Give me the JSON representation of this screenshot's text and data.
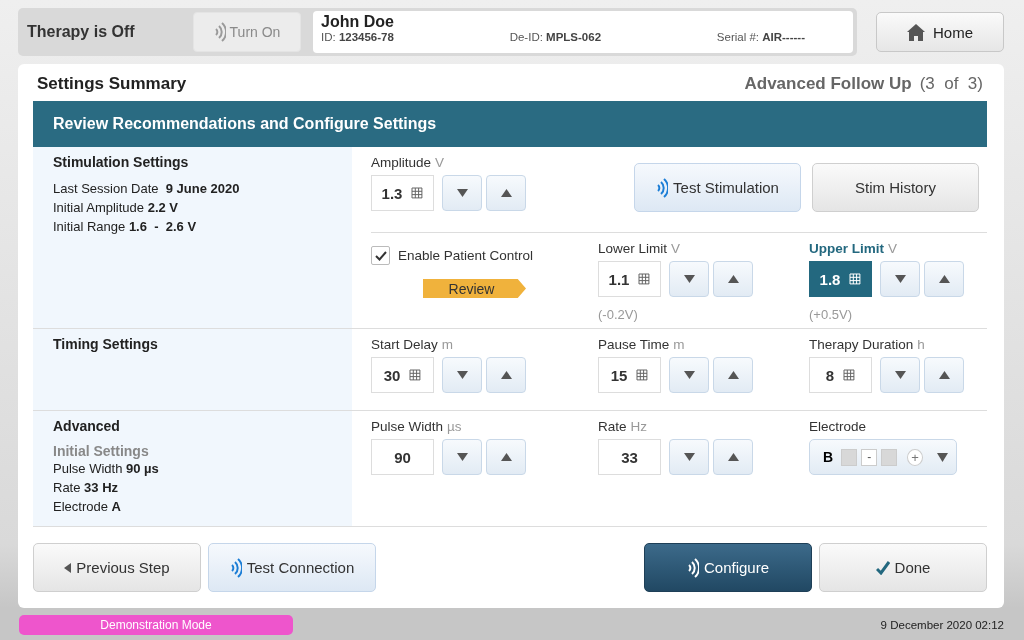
{
  "status_bar": {
    "therapy": "Therapy is Off",
    "turn_on": {
      "label": "Turn On",
      "disabled": true
    }
  },
  "patient": {
    "name": "John Doe",
    "fields": [
      {
        "label": "ID:",
        "value": "123456-78"
      },
      {
        "label": "De-ID:",
        "value": "MPLS-062"
      },
      {
        "label": "Serial #:",
        "value": "AIR------"
      }
    ]
  },
  "home_button": {
    "label": "Home"
  },
  "page": {
    "title": "Settings Summary",
    "workflow": "Advanced Follow Up",
    "step": "(3  of  3)"
  },
  "header": "Review Recommendations and Configure Settings",
  "sections": [
    {
      "title": "Stimulation Settings",
      "lines": [
        "Last Session Date  **9 June 2020**",
        "Initial Amplitude **2.2 V**",
        "Initial Range **1.6  -  2.6 V**"
      ],
      "rows": [
        [
          {
            "kind": "keypad-spinner",
            "label": "Amplitude",
            "unit": "V",
            "value": "1.3",
            "selected": false
          },
          {
            "kind": "signal-button",
            "label": "Test Stimulation"
          },
          {
            "kind": "plain-button",
            "label": "Stim History"
          }
        ],
        [
          {
            "kind": "checkbox",
            "label": "Enable Patient Control",
            "checked": true,
            "tag": "Review"
          },
          {
            "kind": "keypad-spinner",
            "label": "Lower Limit",
            "unit": "V",
            "value": "1.1",
            "selected": false,
            "note": "(-0.2V)"
          },
          {
            "kind": "keypad-spinner",
            "label": "Upper Limit",
            "unit": "V",
            "value": "1.8",
            "selected": true,
            "note": "(+0.5V)"
          }
        ]
      ]
    },
    {
      "title": "Timing Settings",
      "rows": [
        [
          {
            "kind": "keypad-spinner",
            "label": "Start Delay",
            "unit": "m",
            "value": "30",
            "selected": false
          },
          {
            "kind": "keypad-spinner",
            "label": "Pause Time",
            "unit": "m",
            "value": "15",
            "selected": false
          },
          {
            "kind": "keypad-spinner",
            "label": "Therapy Duration",
            "unit": "h",
            "value": "8",
            "selected": false
          }
        ]
      ]
    },
    {
      "title": "Advanced",
      "subtitle": "Initial Settings",
      "lines": [
        "Pulse Width **90 µs**",
        "Rate **33 Hz**",
        "Electrode **A**"
      ],
      "rows": [
        [
          {
            "kind": "spinner",
            "label": "Pulse Width",
            "unit": "µs",
            "value": "90",
            "selected": false
          },
          {
            "kind": "spinner",
            "label": "Rate",
            "unit": "Hz",
            "value": "33",
            "selected": false
          },
          {
            "kind": "electrode",
            "label": "Electrode",
            "value": "B",
            "contacts": [
              {
                "kind": "blank"
              },
              {
                "kind": "minus",
                "text": "-"
              },
              {
                "kind": "blank"
              },
              {
                "kind": "plus",
                "text": "+"
              }
            ]
          }
        ]
      ]
    }
  ],
  "footer": {
    "left": [
      {
        "kind": "back-button",
        "label": "Previous Step"
      },
      {
        "kind": "signal-button",
        "label": "Test Connection"
      }
    ],
    "right": [
      {
        "kind": "primary-button",
        "label": "Configure"
      },
      {
        "kind": "confirm-button",
        "label": "Done"
      }
    ]
  },
  "bottom": {
    "mode": "Demonstration Mode",
    "datetime": "9 December 2020 02:12"
  }
}
